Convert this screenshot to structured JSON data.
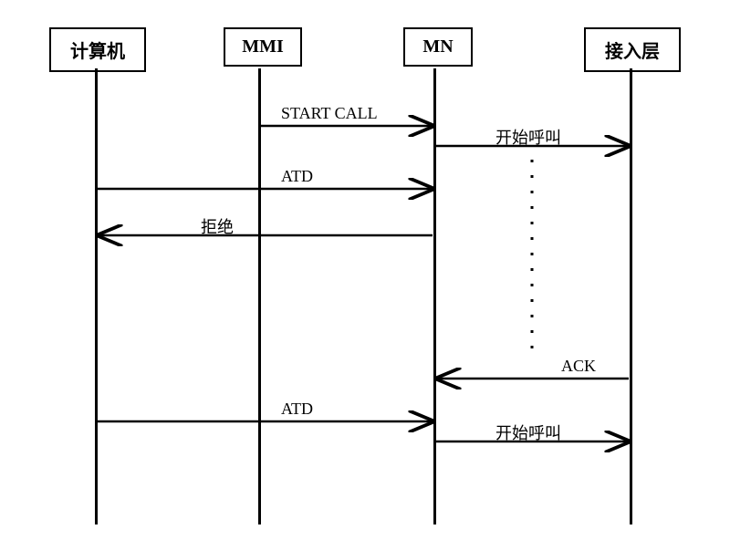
{
  "participants": {
    "p1": "计算机",
    "p2": "MMI",
    "p3": "MN",
    "p4": "接入层"
  },
  "messages": {
    "m1": "START CALL",
    "m2": "开始呼叫",
    "m3": "ATD",
    "m4": "拒绝",
    "m5": "ACK",
    "m6": "ATD",
    "m7": "开始呼叫"
  },
  "chart_data": {
    "type": "sequence_diagram",
    "participants": [
      "计算机",
      "MMI",
      "MN",
      "接入层"
    ],
    "messages": [
      {
        "from": "MMI",
        "to": "MN",
        "label": "START CALL"
      },
      {
        "from": "MN",
        "to": "接入层",
        "label": "开始呼叫"
      },
      {
        "from": "计算机",
        "to": "MN",
        "label": "ATD"
      },
      {
        "from": "MN",
        "to": "计算机",
        "label": "拒绝"
      },
      {
        "from": "接入层",
        "to": "MN",
        "label": "ACK"
      },
      {
        "from": "计算机",
        "to": "MN",
        "label": "ATD"
      },
      {
        "from": "MN",
        "to": "接入层",
        "label": "开始呼叫"
      }
    ]
  }
}
